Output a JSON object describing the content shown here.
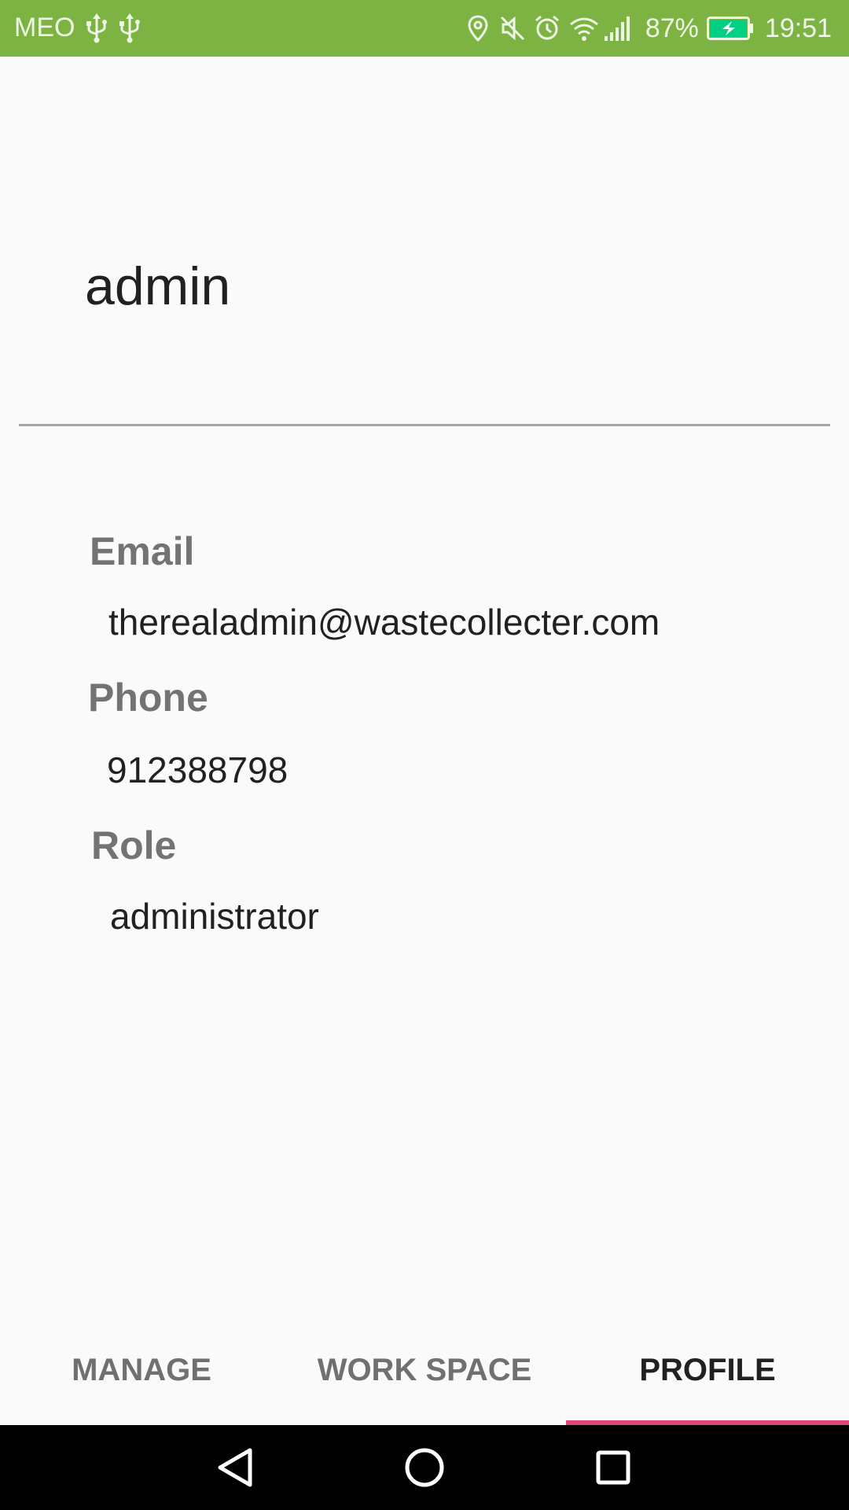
{
  "status_bar": {
    "carrier": "MEO",
    "battery_percent": "87%",
    "time": "19:51",
    "color": "#7cb342",
    "icons": [
      "usb-icon",
      "usb-icon",
      "location-icon",
      "mute-icon",
      "alarm-icon",
      "wifi-icon",
      "signal-icon",
      "battery-charging-icon"
    ]
  },
  "profile": {
    "username": "admin",
    "fields": [
      {
        "label": "Email",
        "value": "therealadmin@wastecollecter.com"
      },
      {
        "label": "Phone",
        "value": "912388798"
      },
      {
        "label": "Role",
        "value": "administrator"
      }
    ]
  },
  "tabs": [
    {
      "label": "MANAGE",
      "selected": false
    },
    {
      "label": "WORK SPACE",
      "selected": false
    },
    {
      "label": "PROFILE",
      "selected": true
    }
  ],
  "tab_indicator_color": "#e0457b",
  "nav_bar": {
    "buttons": [
      "back-icon",
      "home-icon",
      "recents-icon"
    ]
  }
}
